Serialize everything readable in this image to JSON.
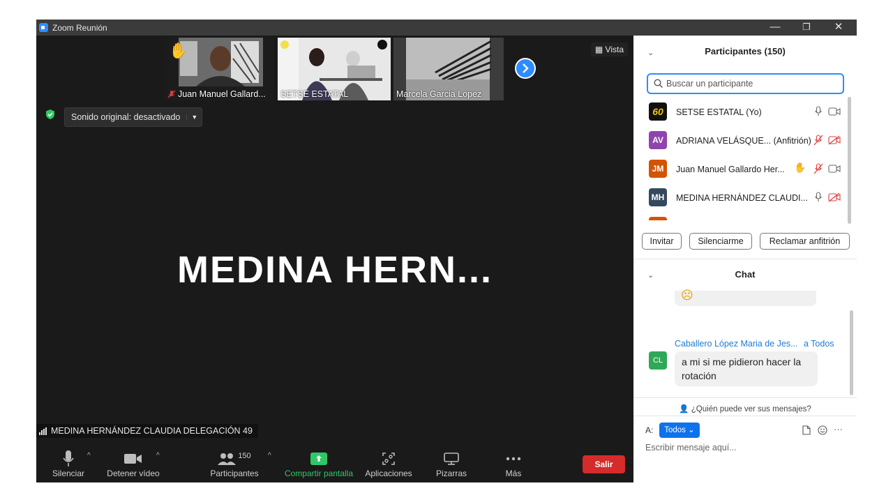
{
  "window": {
    "title": "Zoom Reunión",
    "minimize": "—",
    "maximize": "❐",
    "close": "✕"
  },
  "stage": {
    "thumbnails": [
      {
        "name": "Juan Manuel Gallard..."
      },
      {
        "name": "SETSE ESTATAL"
      },
      {
        "name": "Marcela Garcia Lopez"
      }
    ],
    "view_label": "Vista",
    "sound_original": "Sonido original: desactivado",
    "active_speaker_big": "MEDINA  HERN...",
    "active_speaker_label": "MEDINA HERNÁNDEZ CLAUDIA DELEGACIÓN 49"
  },
  "toolbar": {
    "mute": "Silenciar",
    "stop_video": "Detener vídeo",
    "participants": "Participantes",
    "participants_count": "150",
    "share": "Compartir pantalla",
    "apps": "Aplicaciones",
    "whiteboards": "Pizarras",
    "more": "Más",
    "leave": "Salir"
  },
  "participants_panel": {
    "title": "Participantes (150)",
    "search_placeholder": "Buscar un participante",
    "list": [
      {
        "avatar": "60",
        "name": "SETSE ESTATAL (Yo)",
        "color": "#111111"
      },
      {
        "avatar": "AV",
        "name": "ADRIANA VELÁSQUE... (Anfitrión)",
        "color": "#8e44ad"
      },
      {
        "avatar": "JM",
        "name": "Juan Manuel Gallardo Her...",
        "color": "#d35400"
      },
      {
        "avatar": "MH",
        "name": "MEDINA HERNÁNDEZ CLAUDI...",
        "color": "#34495e"
      }
    ],
    "invite": "Invitar",
    "mute_me": "Silenciarme",
    "claim_host": "Reclamar anfitrión"
  },
  "chat": {
    "title": "Chat",
    "sender": "Caballero López Maria de Jes...",
    "recipient": "a Todos",
    "sender_avatar": "CL",
    "message": "a mi si me pidieron hacer la rotación",
    "who_can_see": "¿Quién puede ver sus mensajes?",
    "to_label": "A:",
    "to_value": "Todos ⌄",
    "input_placeholder": "Escribir mensaje aquí..."
  },
  "colors": {
    "accent": "#2d8cff",
    "leave": "#d52b2b",
    "share": "#2ec866"
  }
}
